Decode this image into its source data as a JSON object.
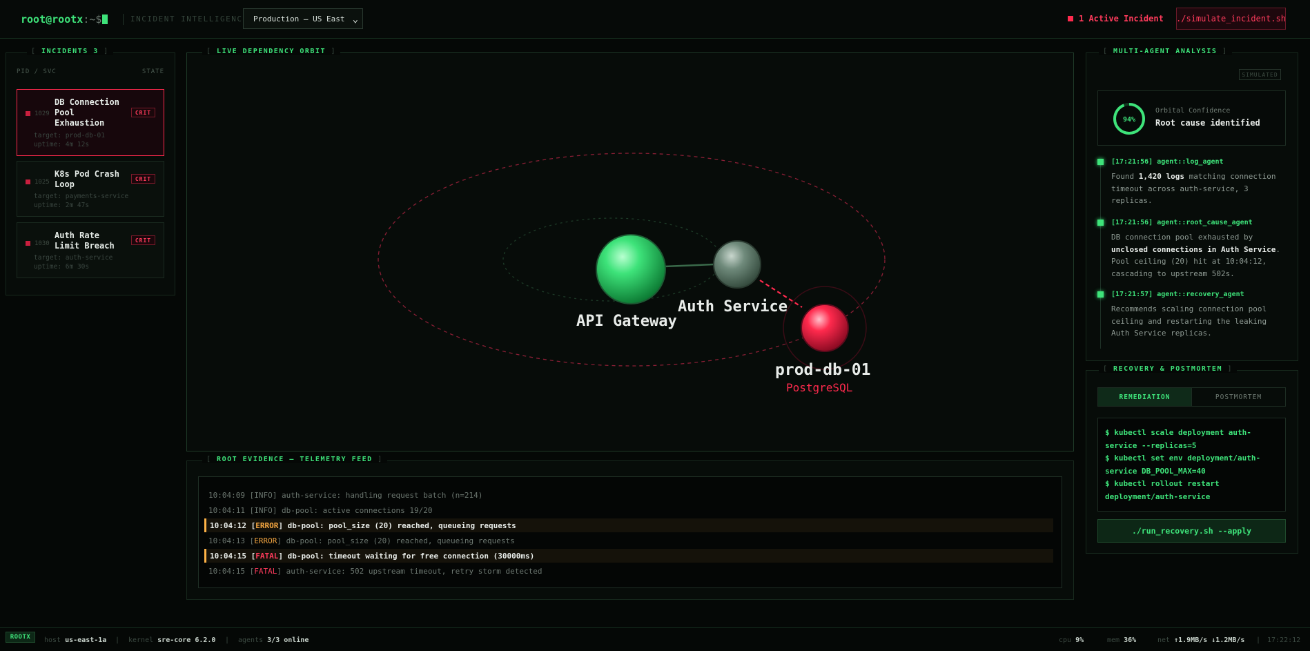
{
  "topbar": {
    "prompt_user": "root@rootx",
    "prompt_path": ":~$",
    "section_label": "INCIDENT INTELLIGENCE",
    "environment": "Production — US East",
    "active_incidents": "1 Active Incident",
    "simulate_button": "./simulate_incident.sh"
  },
  "incidents": {
    "title": "INCIDENTS 3",
    "col_left": "PID / SVC",
    "col_right": "STATE",
    "items": [
      {
        "pid": "1029",
        "title": "DB Connection Pool Exhaustion",
        "state": "CRIT",
        "target": "target: prod-db-01",
        "uptime": "uptime: 4m 12s"
      },
      {
        "pid": "1025",
        "title": "K8s Pod Crash Loop",
        "state": "CRIT",
        "target": "target: payments-service",
        "uptime": "uptime: 2m 47s"
      },
      {
        "pid": "1030",
        "title": "Auth Rate Limit Breach",
        "state": "CRIT",
        "target": "target: auth-service",
        "uptime": "uptime: 6m 30s"
      }
    ]
  },
  "orbit": {
    "title": "LIVE DEPENDENCY ORBIT",
    "nodes": [
      {
        "name": "API Gateway",
        "color": "#3ee37a"
      },
      {
        "name": "Auth Service",
        "color": "#7e9a8a"
      },
      {
        "name": "prod-db-01",
        "subtitle": "PostgreSQL",
        "color": "#ff2a4d"
      }
    ]
  },
  "telemetry": {
    "title": "ROOT EVIDENCE — TELEMETRY FEED",
    "lines": [
      {
        "time": "10:04:09",
        "level": "INFO",
        "msg": "auth-service: handling request batch (n=214)",
        "highlight": false
      },
      {
        "time": "10:04:11",
        "level": "INFO",
        "msg": "db-pool: active connections 19/20",
        "highlight": false
      },
      {
        "time": "10:04:12",
        "level": "ERROR",
        "msg": "db-pool: pool_size (20) reached, queueing requests",
        "highlight": true
      },
      {
        "time": "10:04:13",
        "level": "ERROR",
        "msg": "db-pool: pool_size (20) reached, queueing requests",
        "highlight": false
      },
      {
        "time": "10:04:15",
        "level": "FATAL",
        "msg": "db-pool: timeout waiting for free connection (30000ms)",
        "highlight": true
      },
      {
        "time": "10:04:15",
        "level": "FATAL",
        "msg": "auth-service: 502 upstream timeout, retry storm detected",
        "highlight": false
      }
    ]
  },
  "analysis": {
    "title": "MULTI-AGENT ANALYSIS",
    "badge": "SIMULATED",
    "confidence_value": 0.94,
    "confidence_text": "94%",
    "confidence_label": "Orbital Confidence",
    "confidence_status": "Root cause identified",
    "agents": [
      {
        "head": "[17:21:56] agent::log_agent",
        "pre": "Found ",
        "bold": "1,420 logs",
        "post": " matching connection timeout across auth-service, 3 replicas."
      },
      {
        "head": "[17:21:56] agent::root_cause_agent",
        "pre": "DB connection pool exhausted by ",
        "bold": "unclosed connections in Auth Service",
        "post": ". Pool ceiling (20) hit at 10:04:12, cascading to upstream 502s."
      },
      {
        "head": "[17:21:57] agent::recovery_agent",
        "pre": "Recommends scaling connection pool ceiling and restarting the leaking Auth Service replicas.",
        "bold": "",
        "post": ""
      }
    ]
  },
  "recovery": {
    "title": "RECOVERY & POSTMORTEM",
    "tabs": [
      "REMEDIATION",
      "POSTMORTEM"
    ],
    "commands": [
      "$ kubectl scale deployment auth-service --replicas=5",
      "$ kubectl set env deployment/auth-service DB_POOL_MAX=40",
      "$ kubectl rollout restart deployment/auth-service"
    ],
    "apply_button": "./run_recovery.sh --apply"
  },
  "statusbar": {
    "brand": "ROOTX",
    "host_label": "host",
    "host": "us-east-1a",
    "kernel_label": "kernel",
    "kernel": "sre-core 6.2.0",
    "agents_label": "agents",
    "agents": "3/3 online",
    "cpu_label": "cpu",
    "cpu": "9%",
    "mem_label": "mem",
    "mem": "36%",
    "net_label": "net",
    "net": "↑1.9MB/s ↓1.2MB/s",
    "clock": "17:22:12"
  }
}
